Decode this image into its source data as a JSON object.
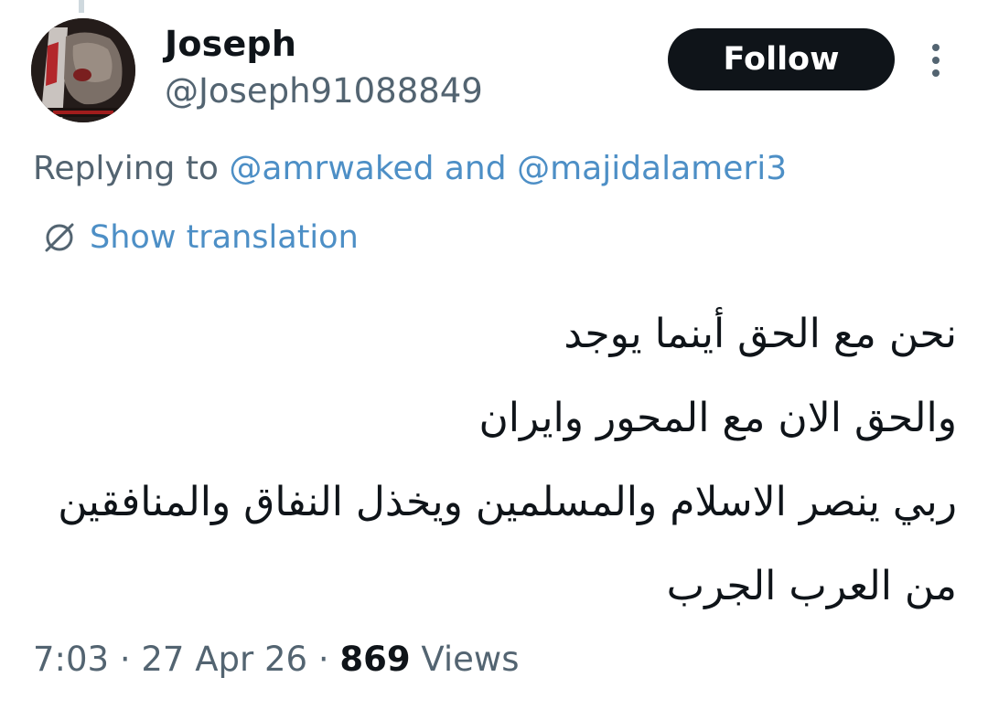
{
  "user": {
    "display_name": "Joseph",
    "handle": "@Joseph91088849",
    "avatar_icon": "profile-photo"
  },
  "actions": {
    "follow_label": "Follow",
    "more_icon": "more-vertical-icon"
  },
  "reply": {
    "prefix": "Replying to",
    "mention_1": "@amrwaked",
    "conjunction": "and",
    "mention_2": "@majidalameri3"
  },
  "translation": {
    "icon": "globe-slash-icon",
    "label": "Show translation"
  },
  "tweet": {
    "lines": [
      "نحن مع الحق أينما يوجد",
      "والحق الان مع المحور وايران",
      "ربي ينصر الاسلام والمسلمين ويخذل النفاق والمنافقين",
      "من العرب الجرب"
    ]
  },
  "meta": {
    "time": "7:03",
    "separator": "·",
    "date": "27 Apr 26",
    "views_count": "869",
    "views_label": "Views"
  },
  "colors": {
    "text_primary": "#0f1419",
    "text_secondary": "#536471",
    "link": "#4d8fc6",
    "button_bg": "#0f1419"
  }
}
